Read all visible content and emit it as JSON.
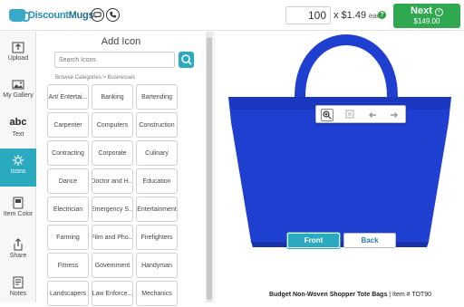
{
  "brand": {
    "name_left": "Discount",
    "name_right": "Mugs"
  },
  "header": {
    "quantity": "100",
    "price_times": "x $1.49",
    "price_each": "each",
    "info_icon": "info-icon",
    "next_label": "Next",
    "next_total": "$149.00"
  },
  "tools": [
    {
      "label": "Upload",
      "icon": "upload-icon"
    },
    {
      "label": "My Gallery",
      "icon": "gallery-icon"
    },
    {
      "label": "Text",
      "icon": "text-icon",
      "glyph": "abc"
    },
    {
      "label": "Icons",
      "icon": "icons-icon",
      "active": true
    },
    {
      "label": "Item Color",
      "icon": "item-color-icon"
    },
    {
      "label": "Share",
      "icon": "share-icon"
    },
    {
      "label": "Notes",
      "icon": "notes-icon"
    }
  ],
  "panel": {
    "title": "Add Icon",
    "search_placeholder": "Search Icons",
    "breadcrumb": "Browse Categories > Businesses",
    "categories": [
      "Art/ Entertai...",
      "Banking",
      "Bartending",
      "Carpenter",
      "Computers",
      "Construction",
      "Contracting",
      "Corporate",
      "Culinary",
      "Dance",
      "Doctor and H...",
      "Education",
      "Electrician",
      "Emergency S...",
      "Entertainment",
      "Farming",
      "Film and Pho...",
      "Firefighters",
      "Fitness",
      "Government",
      "Handyman",
      "Landscapers",
      "Law Enforce...",
      "Mechanics"
    ]
  },
  "canvas": {
    "bag_color": "#1f3fd1",
    "zoom_tools": [
      "zoom-in-icon",
      "layers-icon",
      "undo-icon",
      "redo-icon"
    ],
    "front_label": "Front",
    "back_label": "Back",
    "product_name": "Budget Non-Woven Shopper Tote Bags",
    "product_item": "| Item # TOT90"
  },
  "colors": {
    "accent": "#2aa9bf",
    "next_green": "#2fa84f",
    "bag_blue": "#1f3fd1"
  }
}
